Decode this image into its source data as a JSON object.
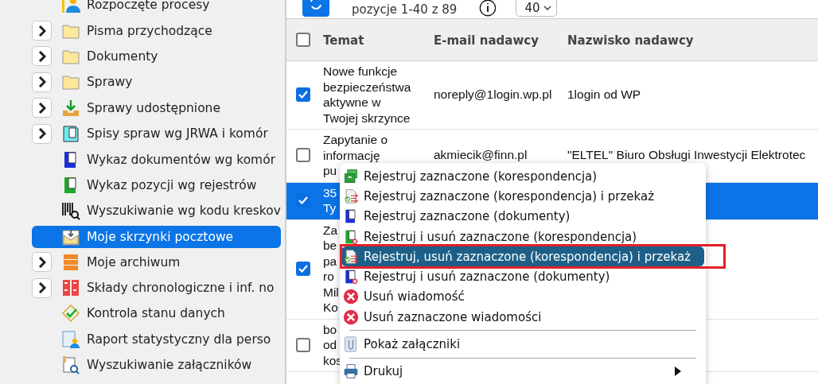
{
  "sidebar": {
    "items": [
      {
        "label": "Rozpoczęte procesy",
        "kind": "person",
        "expandable": false,
        "selected": false
      },
      {
        "label": "Pisma przychodzące",
        "kind": "folder",
        "expandable": true,
        "selected": false
      },
      {
        "label": "Dokumenty",
        "kind": "folder",
        "expandable": true,
        "selected": false
      },
      {
        "label": "Sprawy",
        "kind": "folder",
        "expandable": true,
        "selected": false
      },
      {
        "label": "Sprawy udostępnione",
        "kind": "download",
        "expandable": true,
        "selected": false
      },
      {
        "label": "Spisy spraw wg JRWA i komór",
        "kind": "binder",
        "expandable": true,
        "selected": false
      },
      {
        "label": "Wykaz dokumentów wg komór",
        "kind": "document",
        "expandable": false,
        "selected": false
      },
      {
        "label": "Wykaz pozycji wg rejestrów",
        "kind": "register",
        "expandable": false,
        "selected": false
      },
      {
        "label": "Wyszukiwanie wg kodu kreskov",
        "kind": "barcode",
        "expandable": false,
        "selected": false
      },
      {
        "label": "Moje skrzynki pocztowe",
        "kind": "mailbox",
        "expandable": false,
        "selected": true
      },
      {
        "label": "Moje archiwum",
        "kind": "cabinet",
        "expandable": true,
        "selected": false
      },
      {
        "label": "Składy chronologiczne i inf. no",
        "kind": "boxes",
        "expandable": true,
        "selected": false
      },
      {
        "label": "Kontrola stanu danych",
        "kind": "check",
        "expandable": false,
        "selected": false
      },
      {
        "label": "Raport statystyczny dla perso",
        "kind": "report",
        "expandable": false,
        "selected": false
      },
      {
        "label": "Wyszukiwanie załączników",
        "kind": "search",
        "expandable": false,
        "selected": false
      }
    ]
  },
  "toolbar": {
    "range": "pozycje 1-40 z 89",
    "page_size": "40"
  },
  "table": {
    "header_checked": false,
    "columns": [
      "Temat",
      "E-mail nadawcy",
      "Nazwisko nadawcy"
    ],
    "rows": [
      {
        "checked": true,
        "selected": false,
        "subject": [
          "Nowe funkcje",
          "bezpieczeństwa",
          "aktywne w",
          "Twojej skrzynce"
        ],
        "email": "noreply@1login.wp.pl",
        "sender": "1login od WP"
      },
      {
        "checked": false,
        "selected": false,
        "subject": [
          "Zapytanie o",
          "informację",
          "pu"
        ],
        "email": "akmiecik@finn.pl",
        "sender": "\"ELTEL\" Biuro Obsługi Inwestycji Elektrotec"
      },
      {
        "checked": true,
        "selected": true,
        "subject": [
          "35",
          "Ty"
        ],
        "email": "",
        "sender": ""
      },
      {
        "checked": true,
        "selected": false,
        "subject": [
          "Za",
          "be",
          "pa",
          "ro",
          "Mil",
          "Ko"
        ],
        "email": "",
        "sender": ""
      },
      {
        "checked": false,
        "selected": false,
        "subject": [
          "bo",
          "od",
          "kos"
        ],
        "email": "",
        "sender": ""
      }
    ]
  },
  "context_menu": {
    "items": [
      {
        "kind": "item",
        "label": "Rejestruj zaznaczone (korespondencja)",
        "selected": false,
        "outlined": false,
        "submenu": false
      },
      {
        "kind": "item",
        "label": "Rejestruj zaznaczone (korespondencja) i przekaż",
        "selected": false,
        "outlined": false,
        "submenu": false
      },
      {
        "kind": "item",
        "label": "Rejestruj zaznaczone (dokumenty)",
        "selected": false,
        "outlined": false,
        "submenu": false
      },
      {
        "kind": "item",
        "label": "Rejestruj i usuń zaznaczone (korespondencja)",
        "selected": false,
        "outlined": false,
        "submenu": false
      },
      {
        "kind": "item",
        "label": "Rejestruj, usuń zaznaczone (korespondencja) i przekaż",
        "selected": true,
        "outlined": true,
        "submenu": false
      },
      {
        "kind": "item",
        "label": "Rejestruj i usuń zaznaczone (dokumenty)",
        "selected": false,
        "outlined": false,
        "submenu": false
      },
      {
        "kind": "item",
        "label": "Usuń wiadomość",
        "selected": false,
        "outlined": false,
        "submenu": false
      },
      {
        "kind": "item",
        "label": "Usuń zaznaczone wiadomości",
        "selected": false,
        "outlined": false,
        "submenu": false
      },
      {
        "kind": "separator"
      },
      {
        "kind": "item",
        "label": "Pokaż załączniki",
        "selected": false,
        "outlined": false,
        "submenu": false
      },
      {
        "kind": "separator"
      },
      {
        "kind": "item",
        "label": "Drukuj",
        "selected": false,
        "outlined": false,
        "submenu": true
      }
    ]
  }
}
